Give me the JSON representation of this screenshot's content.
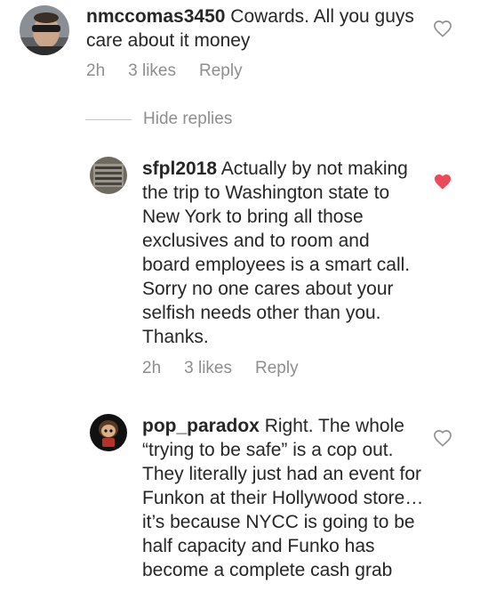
{
  "comments": [
    {
      "username": "nmccomas3450",
      "text": "Cowards. All you guys care about it money",
      "time": "2h",
      "likes": "3 likes",
      "reply": "Reply",
      "liked": false
    },
    {
      "username": "sfpl2018",
      "text": "Actually by not making the trip to Washington state to New York to bring all those exclusives and to room and board employees is a smart call. Sorry no one cares about your selfish needs other than you. Thanks.",
      "time": "2h",
      "likes": "3 likes",
      "reply": "Reply",
      "liked": true
    },
    {
      "username": "pop_paradox",
      "text": "Right. The whole “trying to be safe” is a cop out. They literally just had an event for Funkon at their Hollywood store…it’s because NYCC is going to be half capacity and Funko has become a complete cash grab",
      "liked": false
    }
  ],
  "hide_replies": "Hide replies",
  "colors": {
    "text": "#262626",
    "muted": "#8e8e8e",
    "like_active": "#ed4956"
  },
  "icons": {
    "like_outline": "heart-outline-icon",
    "like_filled": "heart-filled-icon"
  }
}
